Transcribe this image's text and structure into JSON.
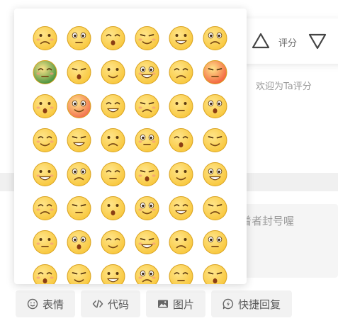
{
  "rating": {
    "label": "评分",
    "hint": "欢迎为Ta评分"
  },
  "comment": {
    "placeholder_tail": "着者封号喔"
  },
  "toolbar": {
    "emoji_label": "表情",
    "code_label": "代码",
    "image_label": "图片",
    "quick_reply_label": "快捷回复"
  },
  "emoji_panel": {
    "rows": 8,
    "columns": 6,
    "emojis": [
      {
        "name": "doubt",
        "color": "#F8C63A"
      },
      {
        "name": "surprised",
        "color": "#F8C63A"
      },
      {
        "name": "angry-hug",
        "color": "#F8C63A"
      },
      {
        "name": "cover-mouth",
        "color": "#F8C63A"
      },
      {
        "name": "sweat",
        "color": "#F8C63A"
      },
      {
        "name": "grin",
        "color": "#F8C63A"
      },
      {
        "name": "soldier",
        "color": "#3E8E3A"
      },
      {
        "name": "cry",
        "color": "#F8C63A"
      },
      {
        "name": "sunglasses",
        "color": "#F8C63A"
      },
      {
        "name": "shy",
        "color": "#F8C63A"
      },
      {
        "name": "shocked",
        "color": "#F8C63A"
      },
      {
        "name": "furious",
        "color": "#F25C3B"
      },
      {
        "name": "headband",
        "color": "#F8C63A"
      },
      {
        "name": "red-sweat",
        "color": "#F26A4B"
      },
      {
        "name": "pray",
        "color": "#F8C63A"
      },
      {
        "name": "big-eyes",
        "color": "#F8C63A"
      },
      {
        "name": "squint",
        "color": "#F8C63A"
      },
      {
        "name": "blush",
        "color": "#F8C63A"
      },
      {
        "name": "crying-hard",
        "color": "#F8C63A"
      },
      {
        "name": "teeth",
        "color": "#F8C63A"
      },
      {
        "name": "frustrated",
        "color": "#F8C63A"
      },
      {
        "name": "smile",
        "color": "#F8C63A"
      },
      {
        "name": "point",
        "color": "#F8C63A"
      },
      {
        "name": "dizzy",
        "color": "#F8C63A"
      },
      {
        "name": "pout",
        "color": "#F8C63A"
      },
      {
        "name": "confused",
        "color": "#F8C63A"
      },
      {
        "name": "smirk",
        "color": "#F8C63A"
      },
      {
        "name": "shush",
        "color": "#F8C63A"
      },
      {
        "name": "sly",
        "color": "#F8C63A"
      },
      {
        "name": "laugh-cry",
        "color": "#F8C63A"
      },
      {
        "name": "sad",
        "color": "#F8C63A"
      },
      {
        "name": "scared",
        "color": "#F8C63A"
      },
      {
        "name": "worried",
        "color": "#F8C63A"
      },
      {
        "name": "cheer",
        "color": "#F8C63A"
      },
      {
        "name": "stare",
        "color": "#F8C63A"
      },
      {
        "name": "upset",
        "color": "#F8C63A"
      },
      {
        "name": "think",
        "color": "#F8C63A"
      },
      {
        "name": "helpless",
        "color": "#F8C63A"
      },
      {
        "name": "giggle",
        "color": "#F8C63A"
      },
      {
        "name": "tongue",
        "color": "#F8C63A"
      },
      {
        "name": "snot",
        "color": "#F8C63A"
      },
      {
        "name": "heart-eyes",
        "color": "#F8C63A"
      },
      {
        "name": "peek",
        "color": "#F8C63A"
      },
      {
        "name": "panic",
        "color": "#F8C63A"
      },
      {
        "name": "wink",
        "color": "#F8C63A"
      },
      {
        "name": "hidden",
        "color": "#F8C63A"
      },
      {
        "name": "pondering",
        "color": "#F8C63A"
      },
      {
        "name": "bleeding",
        "color": "#F8C63A"
      }
    ]
  }
}
